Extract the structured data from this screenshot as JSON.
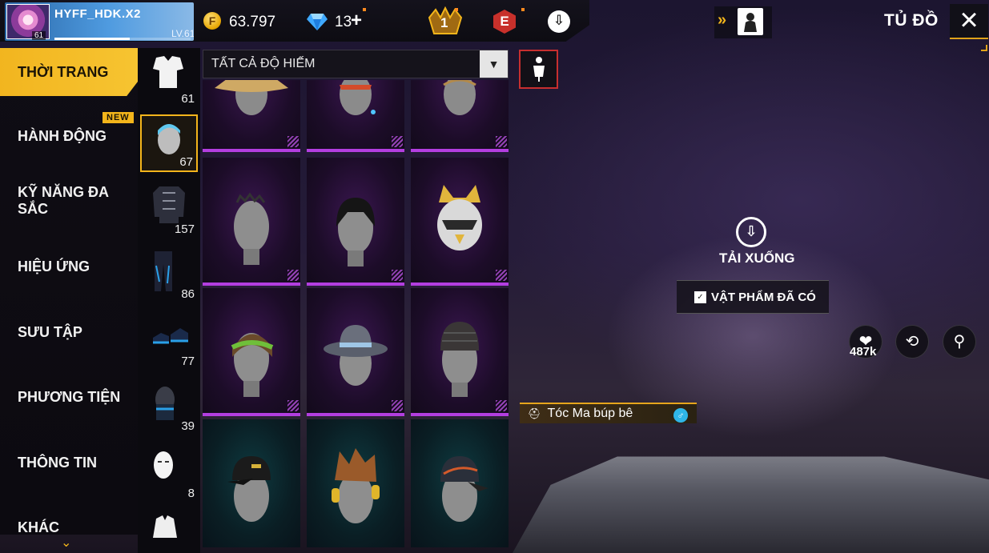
{
  "player": {
    "name": "HYFF_HDK.X2",
    "avatar_level": "61",
    "level_label": "LV.61",
    "xp_fraction": 0.55
  },
  "currency": {
    "gold": "63.797",
    "diamonds": "13",
    "diamond_plus": "+"
  },
  "badges": {
    "rank": "1",
    "elite": "E"
  },
  "header": {
    "title": "TỦ ĐỒ"
  },
  "categories": [
    {
      "label": "THỜI TRANG",
      "active": true
    },
    {
      "label": "HÀNH ĐỘNG",
      "badge": "NEW"
    },
    {
      "label": "KỸ NĂNG ĐA SẮC"
    },
    {
      "label": "HIỆU ỨNG"
    },
    {
      "label": "SƯU TẬP"
    },
    {
      "label": "PHƯƠNG TIỆN"
    },
    {
      "label": "THÔNG TIN"
    },
    {
      "label": "KHÁC"
    }
  ],
  "slots": [
    {
      "icon": "outfit-icon",
      "count": "61"
    },
    {
      "icon": "head-icon",
      "count": "67",
      "active": true
    },
    {
      "icon": "top-icon",
      "count": "157"
    },
    {
      "icon": "pants-icon",
      "count": "86"
    },
    {
      "icon": "shoes-icon",
      "count": "77"
    },
    {
      "icon": "mask-icon",
      "count": "39"
    },
    {
      "icon": "face-icon",
      "count": "8"
    },
    {
      "icon": "jacket-icon",
      "count": ""
    }
  ],
  "filter": {
    "label": "TẤT CẢ ĐỘ HIẾM"
  },
  "items": [
    {
      "name": "conical-hat",
      "rarity": "purple"
    },
    {
      "name": "bandana-head",
      "rarity": "purple"
    },
    {
      "name": "plain-head",
      "rarity": "purple"
    },
    {
      "name": "spiky-head",
      "rarity": "purple"
    },
    {
      "name": "black-bob-hair",
      "rarity": "purple"
    },
    {
      "name": "cat-helmet",
      "rarity": "purple"
    },
    {
      "name": "dreadlock-headband",
      "rarity": "purple"
    },
    {
      "name": "grey-fedora",
      "rarity": "purple"
    },
    {
      "name": "knit-beanie",
      "rarity": "purple"
    },
    {
      "name": "black-cap",
      "rarity": "cyan"
    },
    {
      "name": "headphones-hair",
      "rarity": "cyan"
    },
    {
      "name": "dark-cap",
      "rarity": "cyan"
    }
  ],
  "preview": {
    "download_label": "TẢI XUỐNG",
    "owned_label": "VẬT PHẨM ĐÃ CÓ",
    "likes": "487k",
    "item_name": "Tóc Ma búp bê"
  },
  "colors": {
    "accent": "#f3b51b",
    "rarity_purple": "#b33ee0",
    "elite": "#c8302b"
  }
}
